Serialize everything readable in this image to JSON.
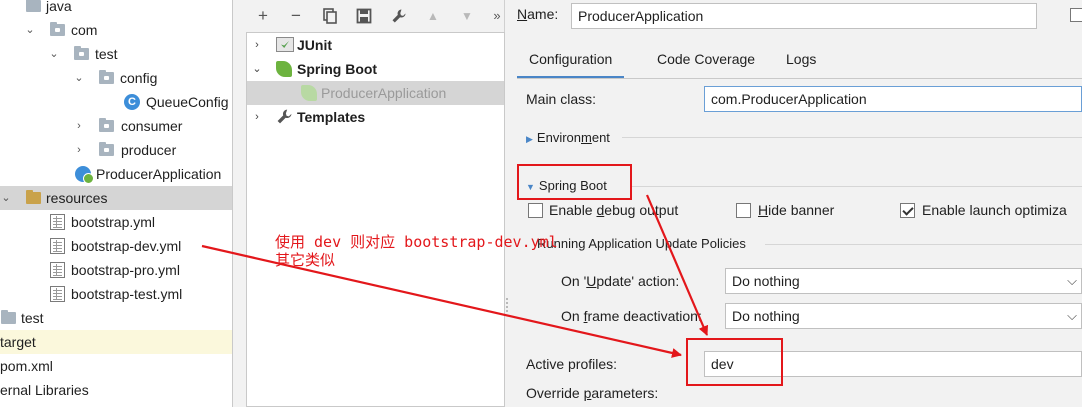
{
  "project_tree": {
    "rows": [
      {
        "label": "java",
        "icon": "folder-icon"
      },
      {
        "label": "com",
        "icon": "package-folder-icon"
      },
      {
        "label": "test",
        "icon": "package-folder-icon"
      },
      {
        "label": "config",
        "icon": "package-folder-icon"
      },
      {
        "label": "QueueConfig",
        "icon": "java-class-icon"
      },
      {
        "label": "consumer",
        "icon": "package-folder-icon"
      },
      {
        "label": "producer",
        "icon": "package-folder-icon"
      },
      {
        "label": "ProducerApplication",
        "icon": "spring-boot-class-icon"
      },
      {
        "label": "resources",
        "icon": "resources-folder-icon"
      },
      {
        "label": "bootstrap.yml",
        "icon": "yml-file-icon"
      },
      {
        "label": "bootstrap-dev.yml",
        "icon": "yml-file-icon"
      },
      {
        "label": "bootstrap-pro.yml",
        "icon": "yml-file-icon"
      },
      {
        "label": "bootstrap-test.yml",
        "icon": "yml-file-icon"
      },
      {
        "label": "test",
        "icon": "folder-icon"
      },
      {
        "label": "target",
        "icon": ""
      },
      {
        "label": "pom.xml",
        "icon": ""
      },
      {
        "label": "ernal Libraries",
        "icon": ""
      }
    ],
    "class_glyph": "C"
  },
  "run_config_toolbar": {
    "add": "+",
    "remove": "−",
    "copy": "copy-icon",
    "save": "save-icon",
    "edit_defaults": "wrench-icon",
    "move_up": "▲",
    "move_down": "▼",
    "more": "»"
  },
  "run_config_tree": {
    "items": [
      {
        "label": "JUnit",
        "icon": "junit-icon"
      },
      {
        "label": "Spring Boot",
        "icon": "spring-boot-icon"
      },
      {
        "label": "ProducerApplication",
        "icon": "spring-boot-leaf-icon"
      },
      {
        "label": "Templates",
        "icon": "wrench-icon"
      }
    ]
  },
  "config_panel": {
    "name_label_prefix": "N",
    "name_label_rest": "ame:",
    "name_value": "ProducerApplication",
    "tabs": [
      "Configuration",
      "Code Coverage",
      "Logs"
    ],
    "main_class_label": "Main class:",
    "main_class_value": "com.ProducerApplication",
    "environment_section_prefix": "Environ",
    "environment_section_mnemonic": "m",
    "environment_section_rest": "ent",
    "spring_boot_section_prefix": "Sprin",
    "spring_boot_section_mnemonic": "g",
    "spring_boot_section_rest": " Boot",
    "debug_output_prefix": "Enable ",
    "debug_output_mnemonic": "d",
    "debug_output_rest": "ebug output",
    "debug_output_checked": false,
    "hide_banner_mnemonic": "H",
    "hide_banner_rest": "ide banner",
    "hide_banner_checked": false,
    "launch_opt_label": "Enable launch optimiza",
    "launch_opt_checked": true,
    "update_policies_label": "Running Application Update Policies",
    "on_update_prefix": "On '",
    "on_update_mnemonic": "U",
    "on_update_rest": "pdate' action:",
    "on_update_value": "Do nothing",
    "on_frame_prefix": "On ",
    "on_frame_mnemonic": "f",
    "on_frame_rest": "rame deactivation:",
    "on_frame_value": "Do nothing",
    "active_profiles_label": "Active profiles:",
    "active_profiles_value": "dev",
    "override_prefix": "Override ",
    "override_mnemonic": "p",
    "override_rest": "arameters:"
  },
  "annotation": {
    "line1": "使用 dev 则对应 bootstrap-dev.yml",
    "line2": "其它类似",
    "color": "#e3171b"
  }
}
